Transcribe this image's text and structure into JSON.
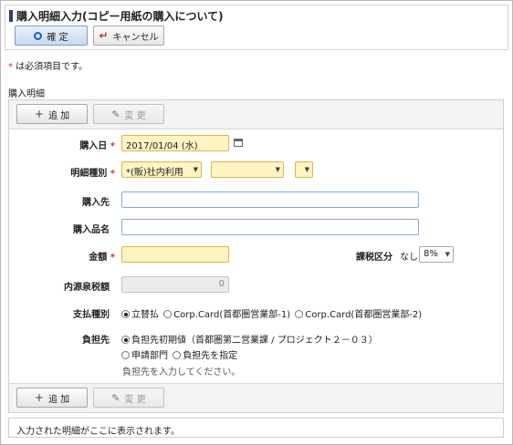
{
  "header": {
    "title": "購入明細入力(コピー用紙の購入について)",
    "confirm_label": "確 定",
    "cancel_label": "キャンセル"
  },
  "required_note": {
    "mark": "*",
    "text": " は必須項目です。"
  },
  "section": {
    "title": "購入明細"
  },
  "toolbar": {
    "add_label": "追 加",
    "change_label": "変 更"
  },
  "form": {
    "purchase_date": {
      "label": "購入日",
      "required": "*",
      "value": "2017/01/04 (水)"
    },
    "detail_type": {
      "label": "明細種別",
      "required": "*",
      "value1": "*(販)社内利用",
      "value2": "",
      "value3": ""
    },
    "vendor": {
      "label": "購入先",
      "value": ""
    },
    "item_name": {
      "label": "購入品名",
      "value": ""
    },
    "amount": {
      "label": "金額",
      "required": "*",
      "value": ""
    },
    "tax_category": {
      "label": "課税区分",
      "prefix": "なし",
      "value": "8%"
    },
    "withholding": {
      "label": "内源泉税額",
      "value": "0"
    },
    "payment_type": {
      "label": "支払種別",
      "options": [
        "立替払",
        "Corp.Card(首都圏営業部-1)",
        "Corp.Card(首都圏営業部-2)"
      ],
      "selected_index": 0
    },
    "burden": {
      "label": "負担先",
      "options": [
        "負担先初期値（首都圏第二営業課 / プロジェクト２－０３）",
        "申請部門",
        "負担先を指定"
      ],
      "selected_index": 0,
      "hint": "負担先を入力してください。"
    }
  },
  "footer": {
    "text": "入力された明細がここに表示されます。"
  },
  "icons": {
    "confirm": "circle-icon",
    "cancel": "return-arrow-icon",
    "add": "plus-icon",
    "change": "pencil-icon",
    "calendar": "calendar-icon"
  },
  "colors": {
    "required_bg": "#fff4c2",
    "required_mark": "#e03030",
    "title_bar": "#2a3f6b",
    "input_border": "#8fa8d6"
  }
}
